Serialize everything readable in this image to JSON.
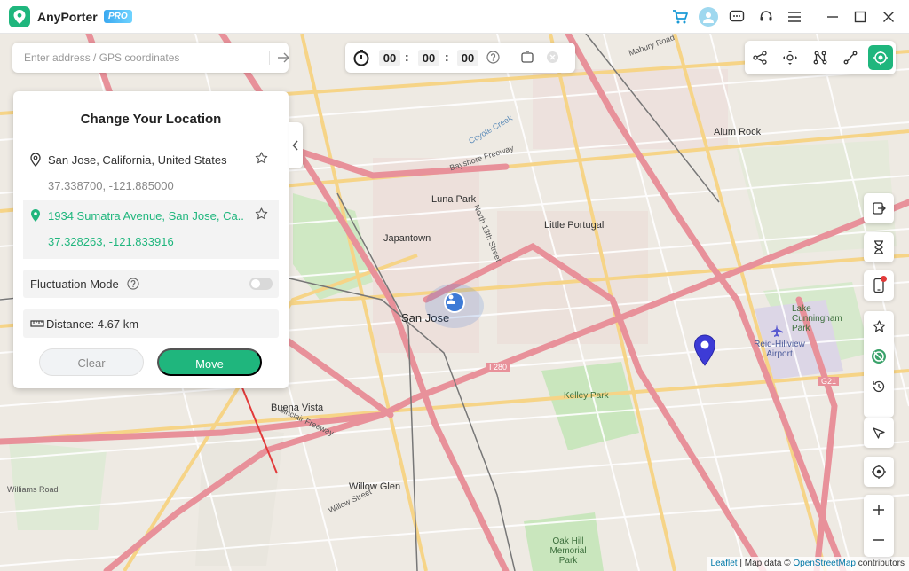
{
  "app": {
    "name": "AnyPorter",
    "badge": "PRO"
  },
  "titlebar_icons": [
    "cart-icon",
    "avatar-icon",
    "chat-icon",
    "support-icon",
    "menu-icon",
    "minimize-icon",
    "maximize-icon",
    "close-icon"
  ],
  "search": {
    "placeholder": "Enter address / GPS coordinates",
    "value": ""
  },
  "timer": {
    "hours": "00",
    "minutes": "00",
    "seconds": "00"
  },
  "modes": [
    "multi-spot-mode",
    "joystick-mode",
    "multi-stop-route",
    "two-spot-route",
    "teleport-mode"
  ],
  "panel": {
    "title": "Change Your Location",
    "origin": {
      "name": "San Jose, California, United States",
      "coords": "37.338700, -121.885000"
    },
    "destination": {
      "name": "1934 Sumatra Avenue, San Jose, Ca...",
      "coords": "37.328263, -121.833916"
    },
    "fluctuation_label": "Fluctuation Mode",
    "fluctuation_on": false,
    "distance": "Distance: 4.67 km",
    "clear_label": "Clear",
    "move_label": "Move"
  },
  "map_labels": {
    "san_jose": "San Jose",
    "luna_park": "Luna Park",
    "japantown": "Japantown",
    "little_portugal": "Little Portugal",
    "alum_rock": "Alum Rock",
    "buena_vista": "Buena Vista",
    "willow_glen": "Willow Glen",
    "kelley_park": "Kelley Park",
    "oak_hill": "Oak Hill Memorial Park",
    "lake_cunningham": "Lake Cunningham Park",
    "reid_hillview": "Reid-Hillview Airport",
    "williams_road": "Williams Road",
    "i280": "I 280",
    "g21": "G21",
    "bayshore": "Bayshore Freeway",
    "sinclair": "Sinclair Freeway",
    "mabury": "Mabury Road",
    "n13": "North 13th Street",
    "coyote": "Coyote Creek",
    "willow_street": "Willow Street"
  },
  "attribution": {
    "leaflet": "Leaflet",
    "sep": " | Map data © ",
    "osm": "OpenStreetMap",
    "suffix": " contributors"
  },
  "colors": {
    "accent": "#1fb67d",
    "marker": "#3d3bd6",
    "highway": "#e8919a",
    "major_road": "#f7d48a"
  }
}
